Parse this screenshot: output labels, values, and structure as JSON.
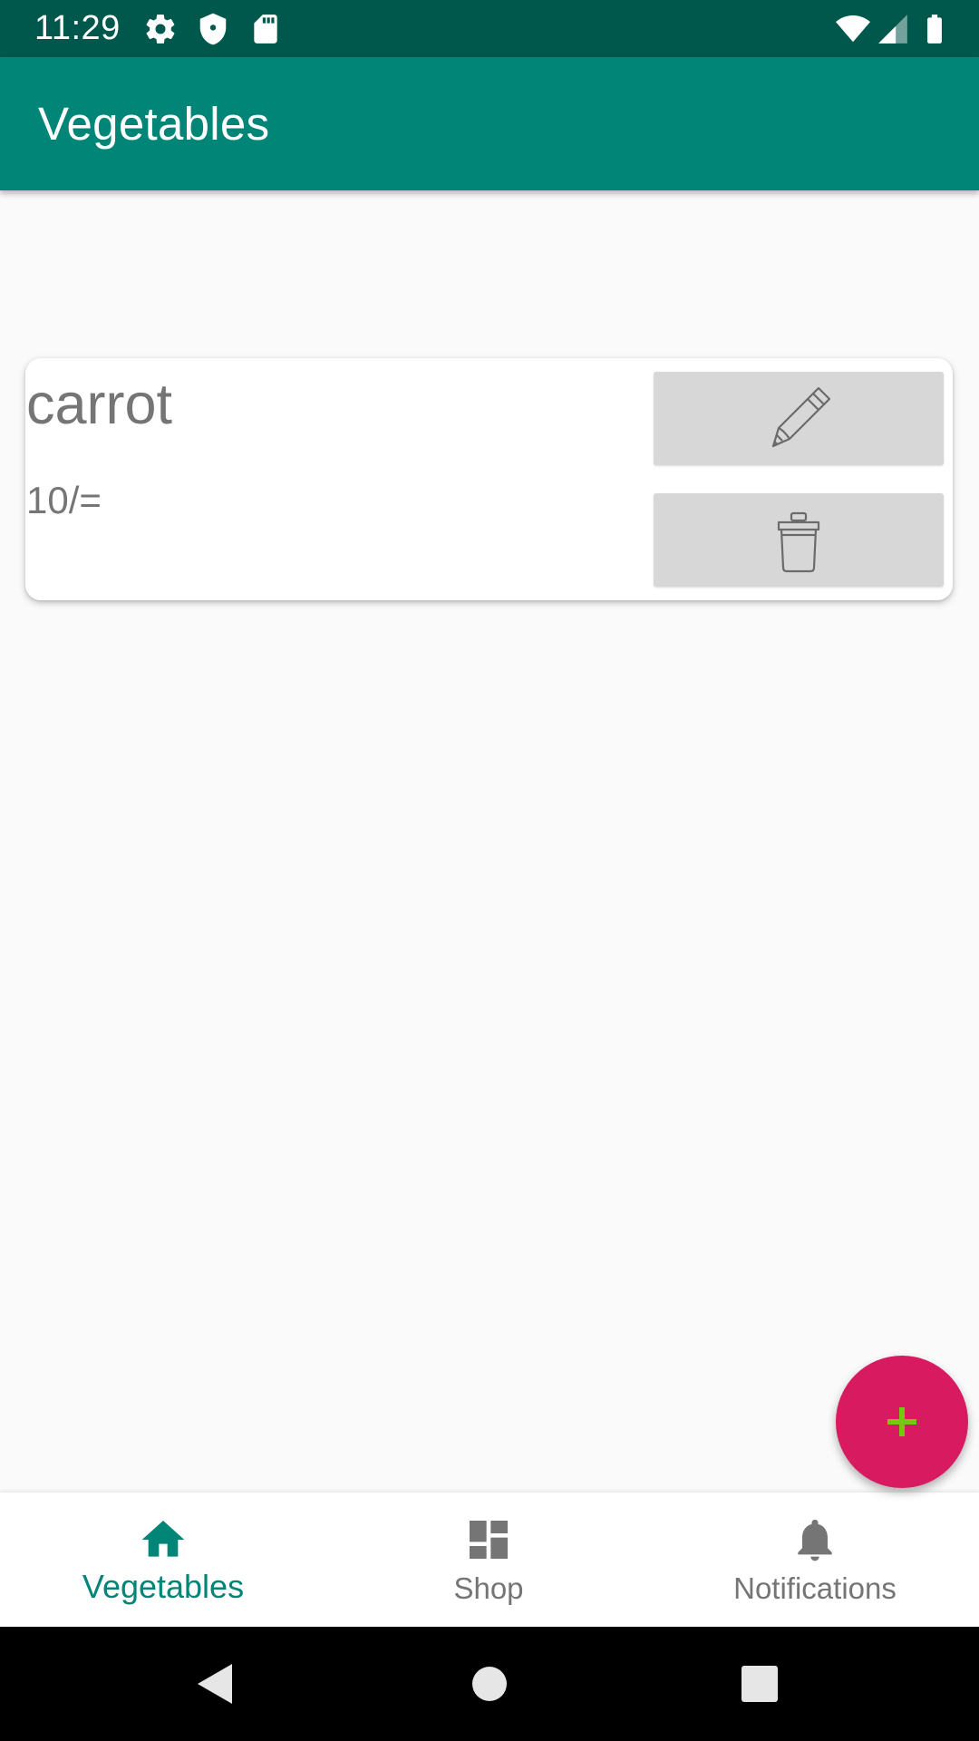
{
  "status_bar": {
    "time": "11:29",
    "icons": [
      "settings-icon",
      "shield-icon",
      "sd-card-icon",
      "wifi-icon",
      "signal-icon",
      "battery-icon"
    ]
  },
  "app_bar": {
    "title": "Vegetables",
    "color": "#008577"
  },
  "items": [
    {
      "name": "carrot",
      "price": "10/=",
      "edit_icon": "pencil-icon",
      "delete_icon": "trash-icon"
    }
  ],
  "fab": {
    "icon": "plus-icon",
    "color": "#d81b60",
    "icon_color": "#76c80c"
  },
  "bottom_nav": {
    "active": "Vegetables",
    "items": [
      {
        "label": "Vegetables",
        "icon": "home-icon"
      },
      {
        "label": "Shop",
        "icon": "dashboard-icon"
      },
      {
        "label": "Notifications",
        "icon": "bell-icon"
      }
    ]
  },
  "system_nav": {
    "buttons": [
      "back-icon",
      "home-circle-icon",
      "recents-icon"
    ]
  }
}
